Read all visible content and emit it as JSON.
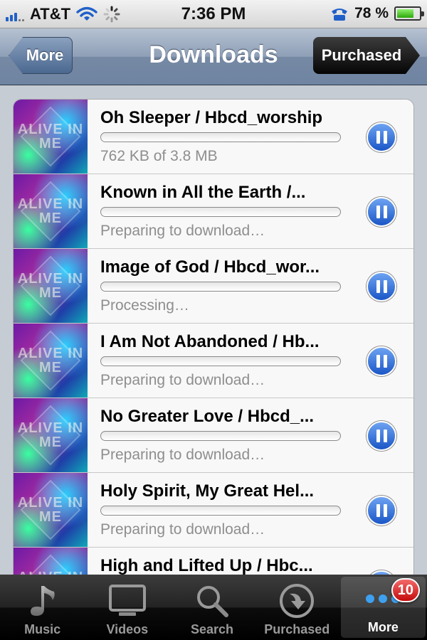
{
  "status_bar": {
    "carrier": "AT&T",
    "time": "7:36 PM",
    "battery_percent": "78 %",
    "battery_level": 0.78
  },
  "nav": {
    "back_label": "More",
    "title": "Downloads",
    "forward_label": "Purchased"
  },
  "album_art_text": "ALIVE IN ME",
  "downloads": [
    {
      "title": "Oh Sleeper / Hbcd_worship",
      "status": "762 KB of 3.8 MB",
      "progress": 0
    },
    {
      "title": "Known in All the Earth /...",
      "status": "Preparing to download…",
      "progress": 0
    },
    {
      "title": "Image of God / Hbcd_wor...",
      "status": "Processing…",
      "progress": 0
    },
    {
      "title": "I Am Not Abandoned / Hb...",
      "status": "Preparing to download…",
      "progress": 0
    },
    {
      "title": "No Greater Love / Hbcd_...",
      "status": "Preparing to download…",
      "progress": 0
    },
    {
      "title": "Holy Spirit, My Great Hel...",
      "status": "Preparing to download…",
      "progress": 0
    },
    {
      "title": "High and Lifted Up / Hbc...",
      "status": "",
      "progress": 0
    }
  ],
  "tab_bar": {
    "tabs": [
      {
        "label": "Music",
        "icon": "music-note-icon"
      },
      {
        "label": "Videos",
        "icon": "tv-icon"
      },
      {
        "label": "Search",
        "icon": "magnifier-icon"
      },
      {
        "label": "Purchased",
        "icon": "download-arrow-icon"
      },
      {
        "label": "More",
        "icon": "more-dots-icon"
      }
    ],
    "selected": "More",
    "more_badge": "10"
  },
  "colors": {
    "nav_bar": "#7689a4",
    "accent_blue": "#1a56c6",
    "badge_red": "#c40b0b",
    "list_background": "#c5ccd4"
  }
}
